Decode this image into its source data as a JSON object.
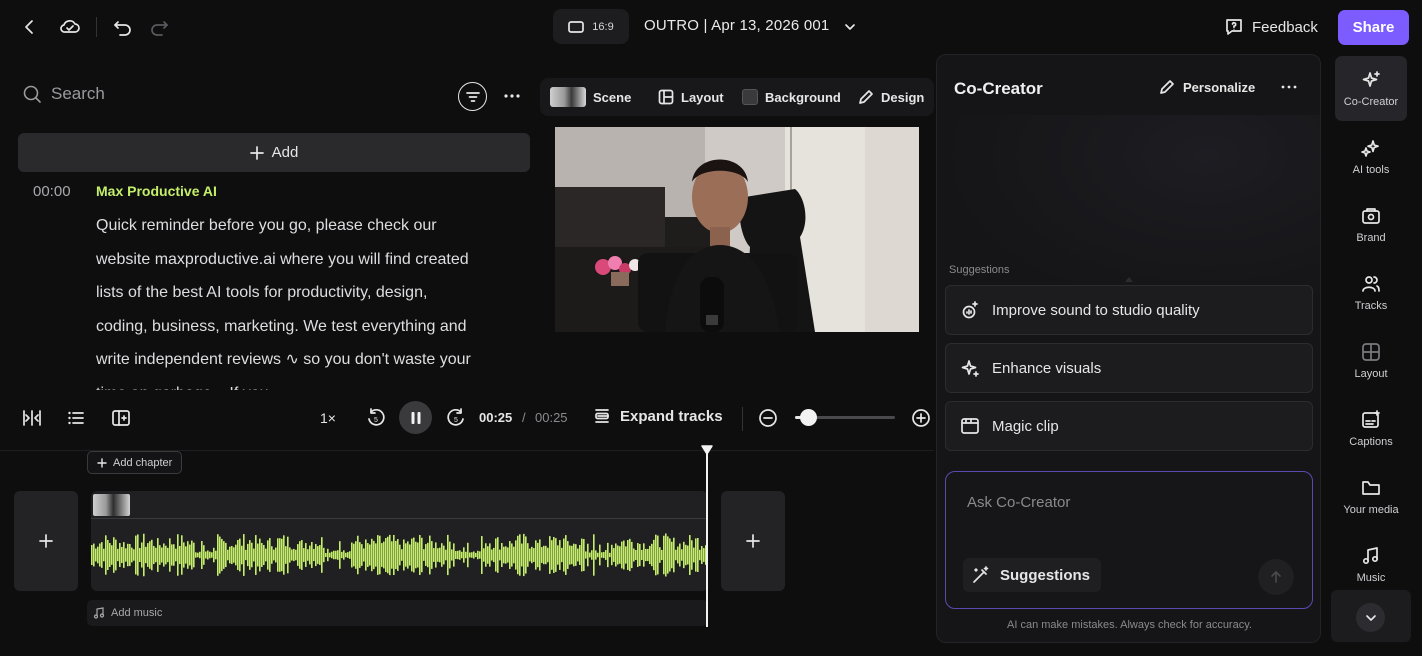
{
  "topbar": {
    "aspect_ratio": "16:9",
    "project_title": "OUTRO | Apr 13, 2026 001",
    "feedback_label": "Feedback",
    "share_label": "Share"
  },
  "script_panel": {
    "search_placeholder": "Search",
    "add_label": "Add",
    "timestamp": "00:00",
    "speaker": "Max Productive AI",
    "text": "Quick reminder before you go, please check our website maxproductive.ai where you will find created lists of the best AI tools for productivity, design, coding, business, marketing. We test everything and write independent reviews ∿ so you don't waste your time on garbage... If you"
  },
  "video_toolbar": {
    "scene_label": "Scene",
    "layout_label": "Layout",
    "background_label": "Background",
    "design_label": "Design"
  },
  "playback": {
    "speed": "1×",
    "current_time": "00:25",
    "separator": "/",
    "duration": "00:25",
    "expand_tracks_label": "Expand tracks",
    "zoom_level": 0.13
  },
  "timeline": {
    "add_chapter_label": "Add chapter",
    "add_music_label": "Add music",
    "waveform_color": "#c5ef6a"
  },
  "cocreator": {
    "title": "Co-Creator",
    "personalize_label": "Personalize",
    "suggestions_label": "Suggestions",
    "suggestions": [
      {
        "label": "Improve sound to studio quality",
        "icon": "magic-audio-icon"
      },
      {
        "label": "Enhance visuals",
        "icon": "sparkle-icon"
      },
      {
        "label": "Magic clip",
        "icon": "film-icon"
      }
    ],
    "ask_placeholder": "Ask Co-Creator",
    "suggestions_button_label": "Suggestions",
    "disclaimer": "AI can make mistakes. Always check for accuracy."
  },
  "rail": {
    "items": [
      {
        "label": "Co-Creator",
        "icon": "sparkle-icon"
      },
      {
        "label": "AI tools",
        "icon": "ai-tools-icon"
      },
      {
        "label": "Brand",
        "icon": "brand-icon"
      },
      {
        "label": "Tracks",
        "icon": "tracks-icon"
      },
      {
        "label": "Layout",
        "icon": "layout-icon"
      },
      {
        "label": "Captions",
        "icon": "captions-icon"
      },
      {
        "label": "Your media",
        "icon": "folder-icon"
      },
      {
        "label": "Music",
        "icon": "music-icon"
      }
    ]
  },
  "colors": {
    "accent": "#7c5cff",
    "speaker": "#c5ef6a",
    "background": "#0e0e0f"
  }
}
